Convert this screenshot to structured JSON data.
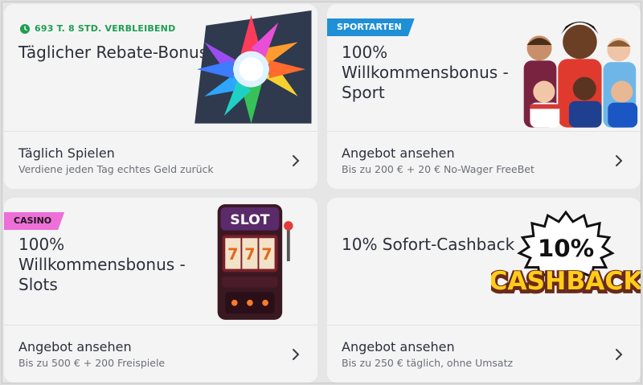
{
  "cards": [
    {
      "timer": "693 T. 8 STD. VERBLEIBEND",
      "title": "Täglicher Rebate-Bonus",
      "action_label": "Täglich Spielen",
      "action_sub": "Verdiene jeden Tag echtes Geld zurück",
      "art_icon": "starburst-gem-icon"
    },
    {
      "tag": "SPORTARTEN",
      "tag_color": "#1f8fd6",
      "title_line1": "100%",
      "title_line2": "Willkommensbonus -",
      "title_line3": "Sport",
      "action_label": "Angebot ansehen",
      "action_sub": "Bis zu 200 € + 20 € No-Wager FreeBet",
      "art_icon": "football-players-icon"
    },
    {
      "tag": "CASINO",
      "tag_color": "#ee6fd8",
      "title_line1": "100%",
      "title_line2": "Willkommensbonus -",
      "title_line3": "Slots",
      "action_label": "Angebot ansehen",
      "action_sub": "Bis zu 500 € + 200 Freispiele",
      "art_icon": "slot-machine-icon",
      "art_text": "SLOT"
    },
    {
      "title": "10% Sofort-Cashback",
      "action_label": "Angebot ansehen",
      "action_sub": "Bis zu 250 € täglich, ohne Umsatz",
      "art_icon": "cashback-badge-icon",
      "art_text_1": "10%",
      "art_text_2": "CASHBACK"
    }
  ],
  "colors": {
    "accent_green": "#1e9e53",
    "text": "#2b2f3a",
    "subtext": "#6c6f77"
  }
}
